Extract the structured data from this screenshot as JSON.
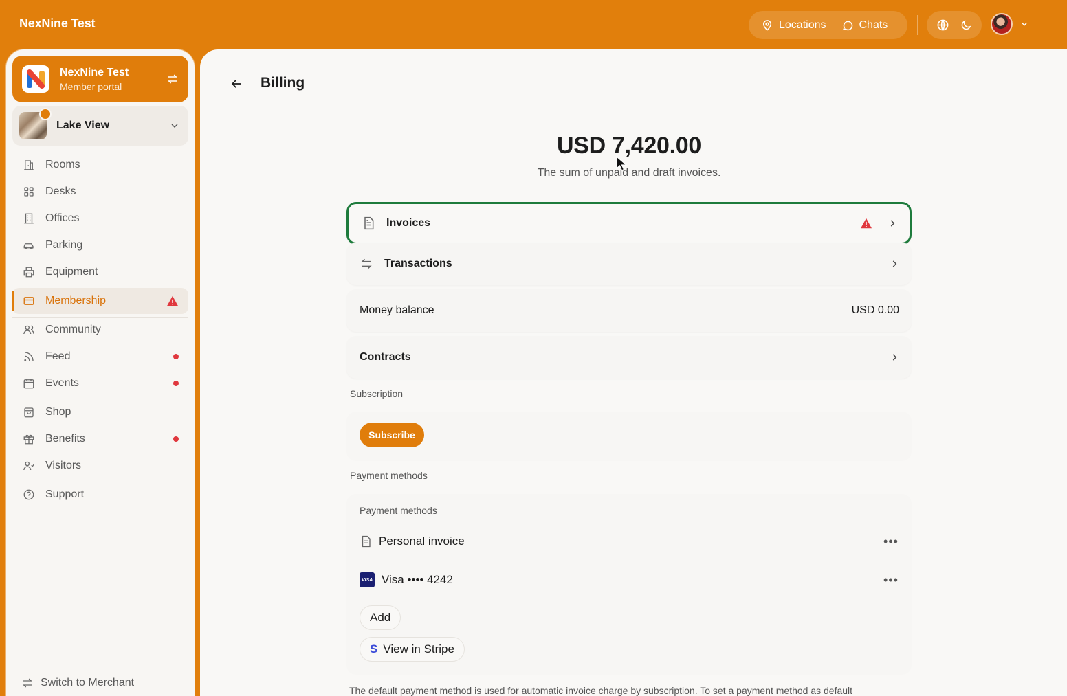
{
  "app": {
    "brand": "NexNine Test",
    "accent": "#e07d0b",
    "highlight": "#1e7b3c",
    "alert": "#e0383e"
  },
  "topnav": {
    "locations": "Locations",
    "chats": "Chats",
    "icons": [
      "map-pin-icon",
      "chat-bubble-icon",
      "globe-icon",
      "moon-icon",
      "chevron-down-icon"
    ]
  },
  "sidebar": {
    "org": {
      "name": "NexNine Test",
      "subtitle": "Member portal"
    },
    "location": {
      "name": "Lake View"
    },
    "items": [
      {
        "label": "Rooms",
        "icon": "rooms-icon"
      },
      {
        "label": "Desks",
        "icon": "desks-icon"
      },
      {
        "label": "Offices",
        "icon": "offices-icon"
      },
      {
        "label": "Parking",
        "icon": "car-icon"
      },
      {
        "label": "Equipment",
        "icon": "printer-icon"
      },
      {
        "label": "Membership",
        "icon": "card-icon",
        "active": true,
        "alert": true
      },
      {
        "label": "Community",
        "icon": "people-icon"
      },
      {
        "label": "Feed",
        "icon": "rss-icon",
        "dot": true
      },
      {
        "label": "Events",
        "icon": "calendar-icon",
        "dot": true
      },
      {
        "label": "Shop",
        "icon": "bag-icon"
      },
      {
        "label": "Benefits",
        "icon": "gift-icon",
        "dot": true
      },
      {
        "label": "Visitors",
        "icon": "visitors-icon"
      },
      {
        "label": "Support",
        "icon": "help-icon"
      }
    ],
    "switch_merchant": "Switch to Merchant"
  },
  "billing": {
    "title": "Billing",
    "total": "USD 7,420.00",
    "total_note": "The sum of unpaid and draft invoices.",
    "invoices": "Invoices",
    "transactions": "Transactions",
    "money_balance_label": "Money balance",
    "money_balance_value": "USD 0.00",
    "contracts": "Contracts",
    "subscription_label": "Subscription",
    "subscribe_btn": "Subscribe",
    "payment_methods_label": "Payment methods",
    "payment_methods_inner": "Payment methods",
    "methods": [
      "Personal invoice",
      "Visa •••• 4242"
    ],
    "add_btn": "Add",
    "stripe_btn": "View in Stripe",
    "stripe_glyph": "S",
    "visa_glyph": "VISA",
    "footnote": "The default payment method is used for automatic invoice charge by subscription. To set a payment method as default"
  }
}
